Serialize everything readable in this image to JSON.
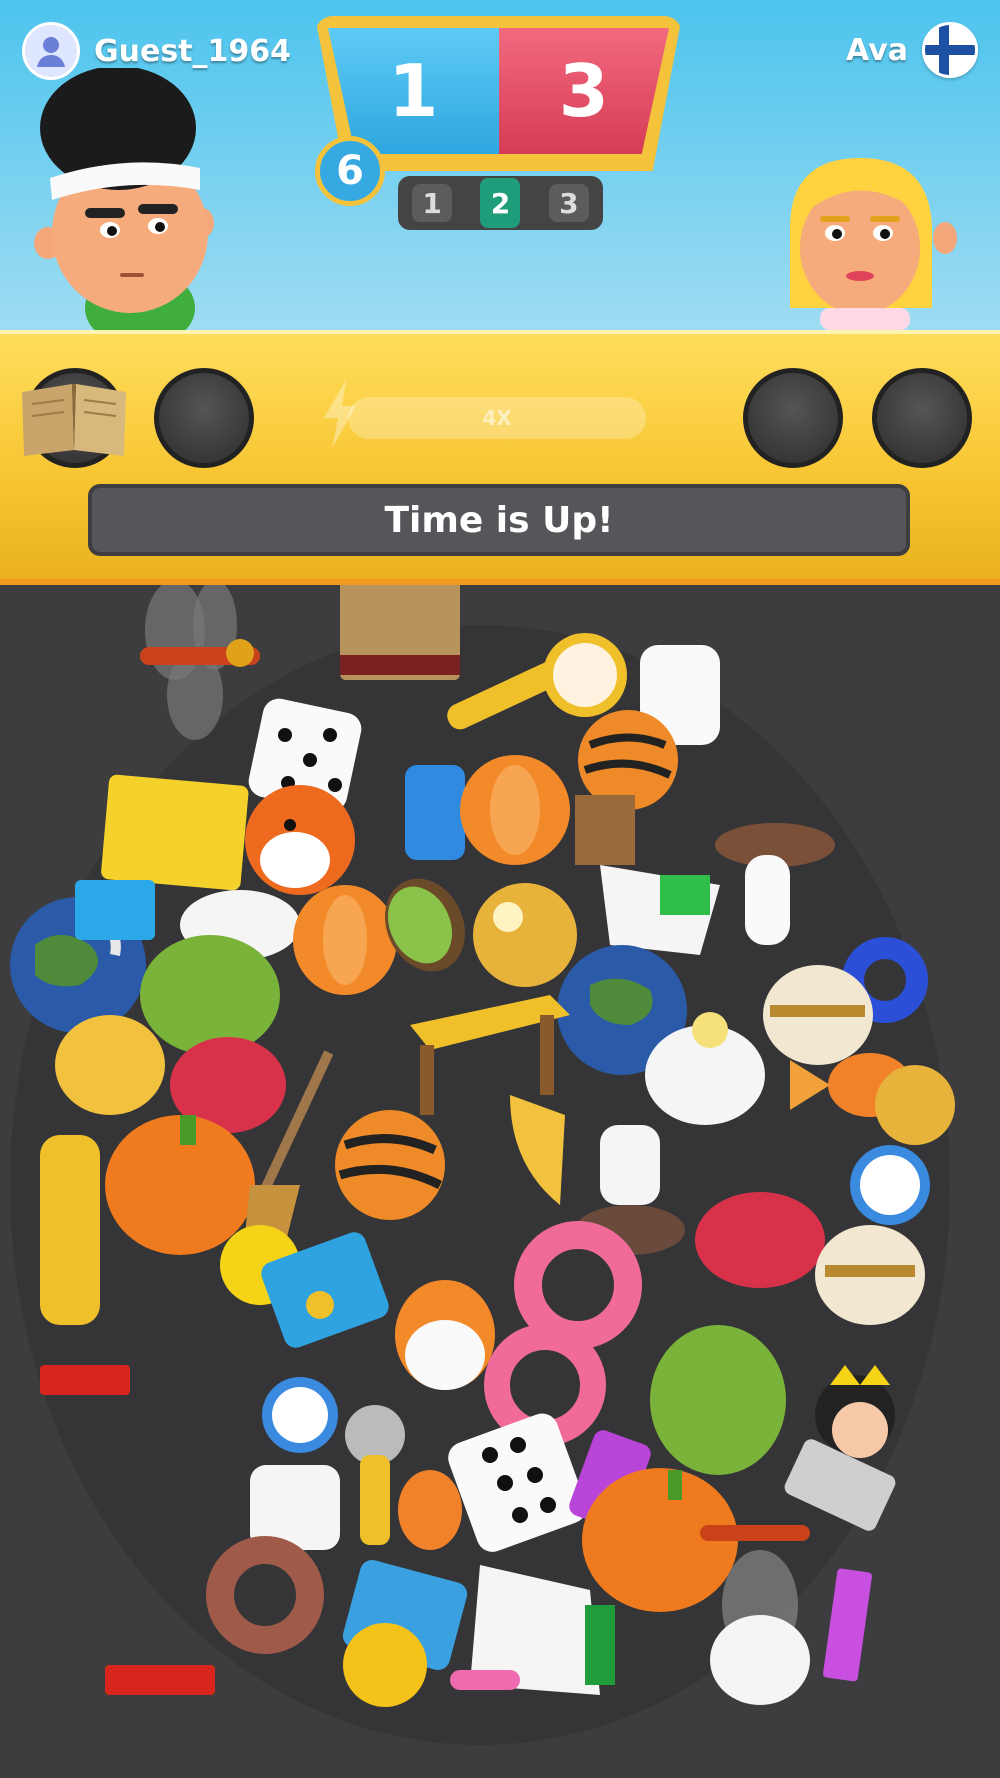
{
  "players": {
    "left": {
      "name": "Guest_1964",
      "avatar_icon": "user-icon"
    },
    "right": {
      "name": "Ava",
      "flag_icon": "finland-flag-icon"
    }
  },
  "scoreboard": {
    "blue_score": "1",
    "red_score": "3",
    "round_badge": "6"
  },
  "rounds": [
    "1",
    "2",
    "3"
  ],
  "current_round": "2",
  "booster": {
    "label": "4X",
    "icon": "lightning-icon"
  },
  "status": {
    "message": "Time is Up!"
  },
  "colors": {
    "blue": "#37a9e2",
    "red": "#d63b55",
    "gold": "#f4c23b",
    "active_round": "#1f9d7a"
  }
}
